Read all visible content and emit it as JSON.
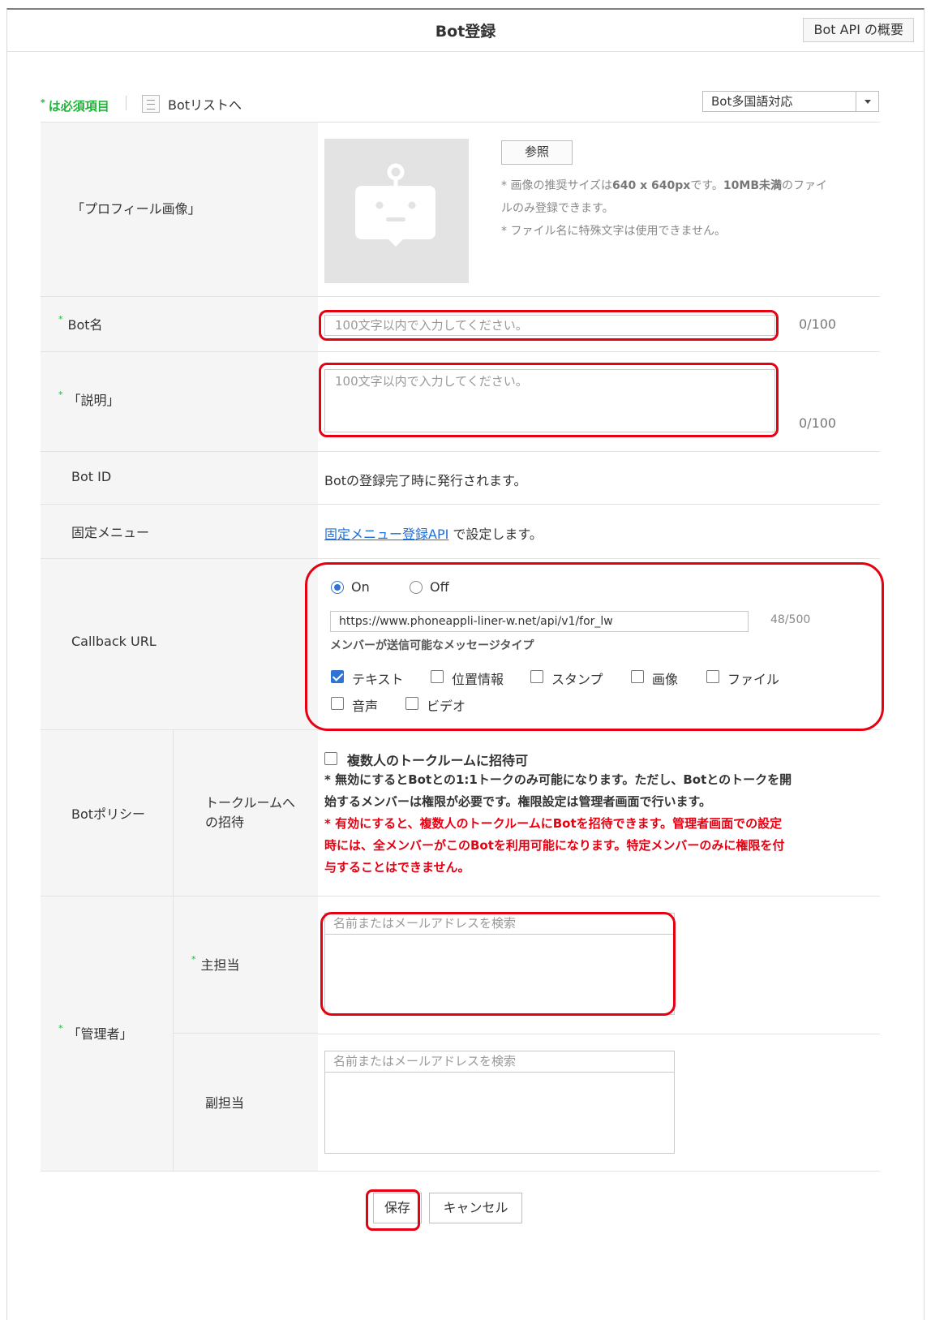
{
  "header": {
    "title": "Bot登録",
    "api_button": "Bot API の概要"
  },
  "toolbar": {
    "required_note": "は必須項目",
    "bot_list_link": "Botリストへ",
    "language_select": "Bot多国語対応"
  },
  "profile": {
    "label": "「プロフィール画像」",
    "browse_button": "参照",
    "hint_prefix": "* 画像の推奨サイズは",
    "hint_size": "640 x 640px",
    "hint_mid": "です。",
    "hint_limit": "10MB未満",
    "hint_suffix": "のファイ",
    "hint_line2": "ルのみ登録できます。",
    "hint_line3": "* ファイル名に特殊文字は使用できません。"
  },
  "bot_name": {
    "label": "Bot名",
    "placeholder": "100文字以内で入力してください。",
    "counter": "0/100"
  },
  "description": {
    "label": "「説明」",
    "placeholder": "100文字以内で入力してください。",
    "counter": "0/100"
  },
  "bot_id": {
    "label": "Bot ID",
    "value": "Botの登録完了時に発行されます。"
  },
  "fixed_menu": {
    "label": "固定メニュー",
    "link": "固定メニュー登録API",
    "suffix": " で設定します。"
  },
  "callback": {
    "label": "Callback URL",
    "on_label": "On",
    "off_label": "Off",
    "url_value": "https://www.phoneappli-liner-w.net/api/v1/for_lw",
    "url_counter": "48/500",
    "message_types_label": "メンバーが送信可能なメッセージタイプ",
    "types": [
      {
        "label": "テキスト",
        "checked": true
      },
      {
        "label": "位置情報",
        "checked": false
      },
      {
        "label": "スタンプ",
        "checked": false
      },
      {
        "label": "画像",
        "checked": false
      },
      {
        "label": "ファイル",
        "checked": false
      },
      {
        "label": "音声",
        "checked": false
      },
      {
        "label": "ビデオ",
        "checked": false
      }
    ]
  },
  "policy": {
    "label": "Botポリシー",
    "sub_label_1": "トークルームへ",
    "sub_label_2": "の招待",
    "checkbox_label": "複数人のトークルームに招待可",
    "note_line1": "* 無効にするとBotとの1:1トークのみ可能になります。ただし、Botとのトークを開",
    "note_line2": "始するメンバーは権限が必要です。権限設定は管理者画面で行います。",
    "warn_line1": "* 有効にすると、複数人のトークルームにBotを招待できます。管理者画面での設定",
    "warn_line2": "時には、全メンバーがこのBotを利用可能になります。特定メンバーのみに権限を付",
    "warn_line3": "与することはできません。"
  },
  "admin": {
    "label": "「管理者」",
    "main_label": "主担当",
    "sub_label": "副担当",
    "main_placeholder": "名前またはメールアドレスを検索",
    "sub_placeholder": "名前またはメールアドレスを検索"
  },
  "actions": {
    "save": "保存",
    "cancel": "キャンセル"
  },
  "colors": {
    "required_green": "#20b33a",
    "highlight_red": "#e60012",
    "link_blue": "#1d6fdc"
  }
}
